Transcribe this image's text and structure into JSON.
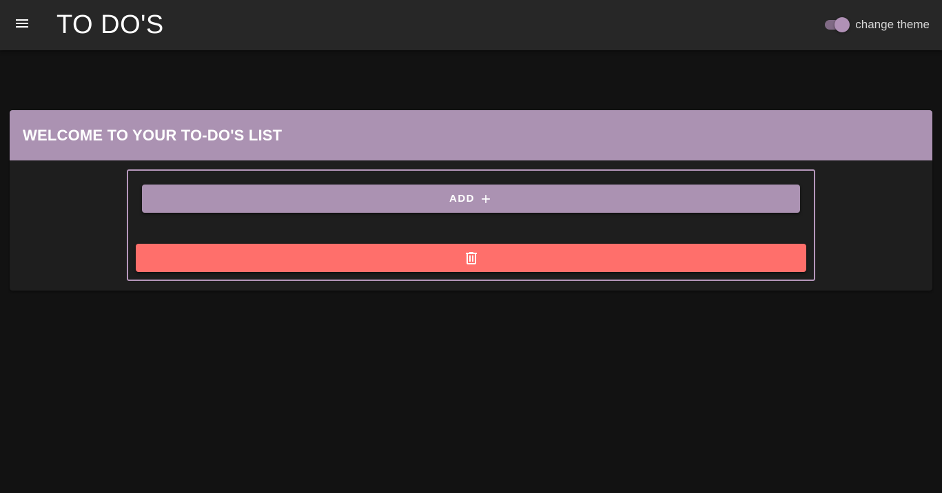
{
  "appbar": {
    "title": "TO DO'S",
    "menu_icon": "menu-icon",
    "theme_toggle": {
      "label": "change theme",
      "checked": true
    }
  },
  "card": {
    "title": "WELCOME TO YOUR TO-DO'S LIST",
    "add_button": {
      "label": "ADD",
      "icon": "plus-icon"
    },
    "delete_button": {
      "icon": "trash-icon"
    }
  },
  "colors": {
    "background": "#121212",
    "appbar": "#272727",
    "accent": "#ab92b2",
    "danger": "#ff6f6b",
    "card": "#1e1e1e"
  }
}
